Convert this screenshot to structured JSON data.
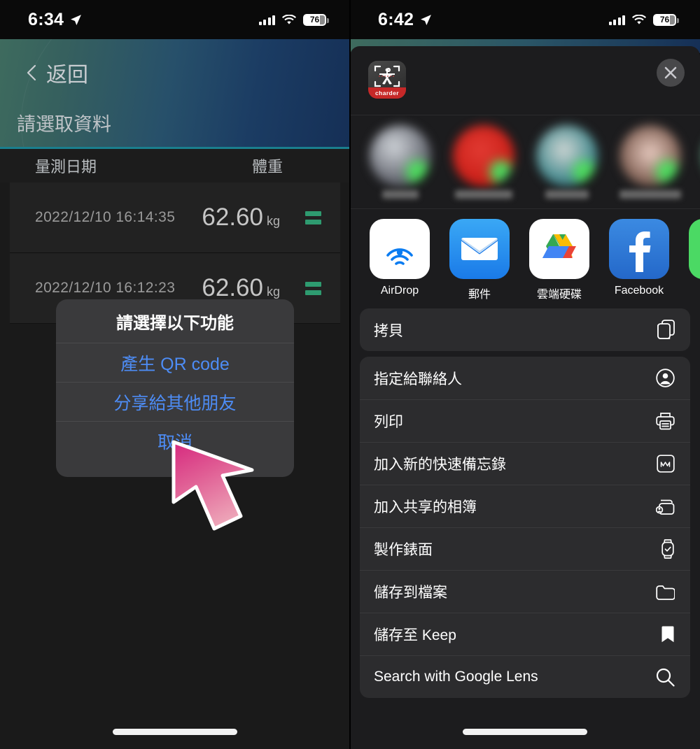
{
  "left_phone": {
    "status_bar": {
      "time": "6:34",
      "battery": "76",
      "location_icon": "location-arrow-icon",
      "signal_icon": "cellular-bars-icon",
      "wifi_icon": "wifi-icon"
    },
    "header": {
      "back_label": "返回",
      "back_icon": "chevron-left-icon",
      "title": "請選取資料"
    },
    "table": {
      "columns": [
        "量測日期",
        "體重"
      ],
      "rows": [
        {
          "date": "2022/12/10  16:14:35",
          "weight": "62.60",
          "unit": "kg",
          "handle_icon": "reorder-handle-icon"
        },
        {
          "date": "2022/12/10  16:12:23",
          "weight": "62.60",
          "unit": "kg",
          "handle_icon": "reorder-handle-icon"
        }
      ]
    },
    "alert": {
      "title": "請選擇以下功能",
      "buttons": [
        "產生 QR code",
        "分享給其他朋友",
        "取消"
      ]
    },
    "cursor_icon": "pointer-arrow-cursor",
    "home_indicator": "home-indicator"
  },
  "right_phone": {
    "status_bar": {
      "time": "6:42",
      "battery": "76",
      "location_icon": "location-arrow-icon",
      "signal_icon": "cellular-bars-icon",
      "wifi_icon": "wifi-icon"
    },
    "share_sheet": {
      "app_icon_label": "charder",
      "close_icon": "close-icon",
      "suggestions": [
        {
          "name": "",
          "badge": "app-badge"
        },
        {
          "name": "",
          "badge": "app-badge"
        },
        {
          "name": "",
          "badge": "app-badge"
        },
        {
          "name": "",
          "badge": "app-badge"
        },
        {
          "name": "",
          "badge": "app-badge"
        }
      ],
      "apps": [
        {
          "label": "AirDrop",
          "icon": "airdrop-icon"
        },
        {
          "label": "郵件",
          "icon": "mail-icon"
        },
        {
          "label": "雲端硬碟",
          "icon": "google-drive-icon"
        },
        {
          "label": "Facebook",
          "icon": "facebook-icon"
        },
        {
          "label": "",
          "icon": "green-app-icon"
        }
      ],
      "action_groups": [
        [
          {
            "label": "拷貝",
            "icon": "copy-icon"
          }
        ],
        [
          {
            "label": "指定給聯絡人",
            "icon": "contact-circle-icon"
          },
          {
            "label": "列印",
            "icon": "printer-icon"
          },
          {
            "label": "加入新的快速備忘錄",
            "icon": "quick-note-icon"
          },
          {
            "label": "加入共享的相簿",
            "icon": "shared-album-icon"
          },
          {
            "label": "製作錶面",
            "icon": "watch-face-icon"
          },
          {
            "label": "儲存到檔案",
            "icon": "folder-icon"
          },
          {
            "label": "儲存至 Keep",
            "icon": "bookmark-icon"
          },
          {
            "label": "Search with Google Lens",
            "icon": "search-icon"
          }
        ]
      ]
    },
    "home_indicator": "home-indicator"
  },
  "colors": {
    "accent_blue": "#4d8cf5",
    "header_gradient_start": "#3e6b5e",
    "header_gradient_end": "#152f56",
    "header_border": "#1a7f8e",
    "handle_green": "#2e9b70",
    "cursor_pink": "#e0418a",
    "sheet_bg": "#1c1c1e",
    "action_bg": "#2c2c2e"
  }
}
